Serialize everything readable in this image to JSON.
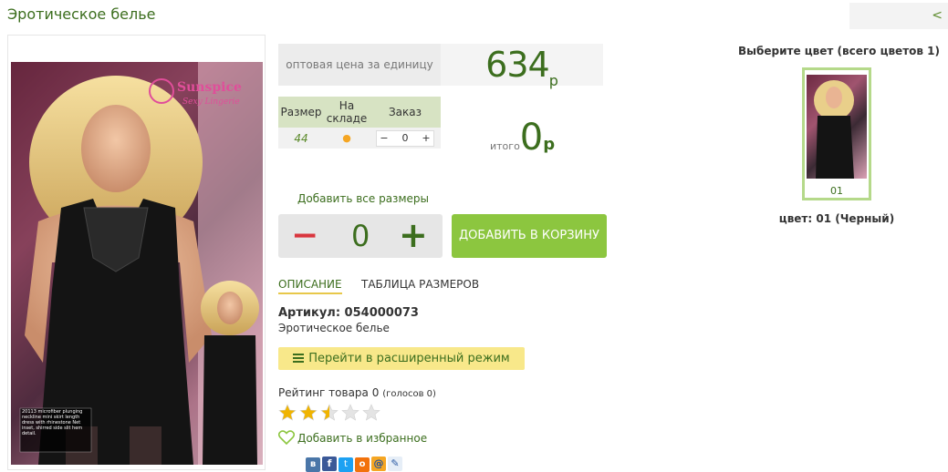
{
  "page": {
    "title": "Эротическое белье",
    "back_label": "<"
  },
  "product": {
    "image": {
      "brand_logo": "Sunspice",
      "brand_sub": "Sexy Lingerie",
      "caption": "20113 microfiber plunging neckline mini skirt length dress with rhinestone Net inset, shirred side slit hem detail."
    },
    "price_label": "оптовая цена за единицу",
    "price_value": "634",
    "price_unit": "р",
    "sizes_table": {
      "headers": [
        "Размер",
        "На складе",
        "Заказ"
      ],
      "rows": [
        {
          "size": "44",
          "in_stock": "●",
          "qty": "0"
        }
      ]
    },
    "total_label": "итого",
    "total_value": "0",
    "total_unit": "р",
    "add_all_label": "Добавить все размеры",
    "big_qty": "0",
    "minus": "−",
    "plus": "+",
    "cart_button": "ДОБАВИТЬ В КОРЗИНУ",
    "tabs": [
      {
        "label": "ОПИСАНИЕ",
        "active": true
      },
      {
        "label": "ТАБЛИЦА РАЗМЕРОВ",
        "active": false
      }
    ],
    "sku": "Артикул: 054000073",
    "category": "Эротическое белье",
    "advanced_mode": "Перейти в расширенный режим",
    "rating_label": "Рейтинг товара",
    "rating_value": "0",
    "votes": "(голосов 0)",
    "rating_stars": 2.5,
    "favorite": "Добавить в избранное",
    "share_icons": [
      "vk-icon",
      "facebook-icon",
      "twitter-icon",
      "odnoklassniki-icon",
      "mailru-icon",
      "livejournal-icon"
    ]
  },
  "colors": {
    "heading": "Выберите цвет (всего цветов 1)",
    "items": [
      {
        "code": "01"
      }
    ],
    "selected_caption": "цвет: 01 (Черный)"
  },
  "theme": {
    "green": "#3c6e1e",
    "accent": "#8cc63f",
    "yellow": "#f8e88a",
    "star": "#f0b400"
  }
}
